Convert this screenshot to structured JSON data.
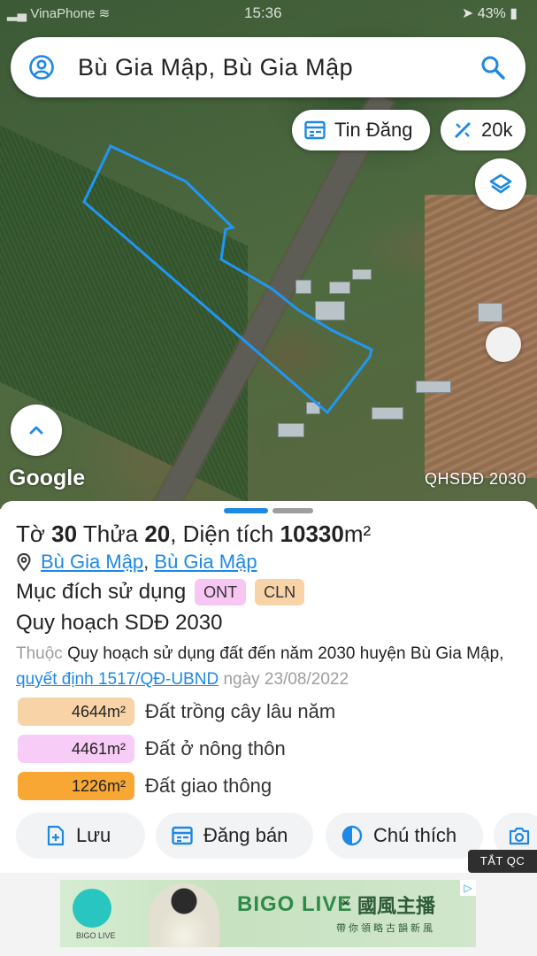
{
  "status_bar": {
    "carrier": "VinaPhone",
    "time": "15:36",
    "battery": "43%"
  },
  "search": {
    "query": "Bù Gia Mập, Bù Gia Mập"
  },
  "map_controls": {
    "listings_label": "Tin Đăng",
    "price_label": "20k",
    "layer_label": "QHSDĐ 2030",
    "google_label": "Google"
  },
  "parcel": {
    "sheet_prefix": "Tờ",
    "sheet_no": "30",
    "lot_prefix": "Thửa",
    "lot_no": "20",
    "area_prefix": ", Diện tích",
    "area": "10330",
    "area_unit": "m²",
    "commune": "Bù Gia Mập",
    "district": "Bù Gia Mập",
    "purpose_label": "Mục đích sử dụng",
    "tags": [
      {
        "code": "ONT",
        "color": "#f7c6f3"
      },
      {
        "code": "CLN",
        "color": "#f9d3a8"
      }
    ]
  },
  "plan": {
    "title": "Quy hoạch SDĐ 2030",
    "belongs": "Thuộc",
    "desc": "Quy hoạch sử dụng đất đến năm 2030 huyện Bù Gia Mập",
    "decision_link": "quyết định 1517/QĐ-UBND",
    "date": "ngày 23/08/2022",
    "areas": [
      {
        "value": "4644m²",
        "label": "Đất trồng cây lâu năm",
        "color": "#f9d3a8"
      },
      {
        "value": "4461m²",
        "label": "Đất ở nông thôn",
        "color": "#f7ccf6"
      },
      {
        "value": "1226m²",
        "label": "Đất giao thông",
        "color": "#f8a735"
      }
    ]
  },
  "actions": {
    "save": "Lưu",
    "post": "Đăng bán",
    "legend": "Chú thích"
  },
  "ad": {
    "close_label": "TẮT QC",
    "brand": "BIGO LIVE",
    "x_sign": "×",
    "cn_text": "國風主播",
    "cn_sub": "帶你領略古韻新風",
    "logo_label": "BIGO LIVE"
  },
  "colors": {
    "accent": "#1e88e5",
    "parcel_outline": "#2196f3"
  }
}
